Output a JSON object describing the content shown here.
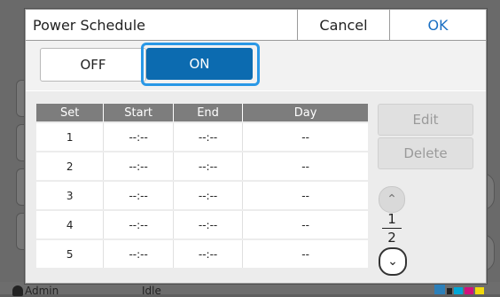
{
  "dialog": {
    "title": "Power Schedule",
    "cancel_label": "Cancel",
    "ok_label": "OK"
  },
  "toggle": {
    "off_label": "OFF",
    "on_label": "ON",
    "selected": "ON"
  },
  "table": {
    "headers": [
      "Set",
      "Start",
      "End",
      "Day"
    ],
    "rows": [
      [
        "1",
        "--:--",
        "--:--",
        "--"
      ],
      [
        "2",
        "--:--",
        "--:--",
        "--"
      ],
      [
        "3",
        "--:--",
        "--:--",
        "--"
      ],
      [
        "4",
        "--:--",
        "--:--",
        "--"
      ],
      [
        "5",
        "--:--",
        "--:--",
        "--"
      ]
    ]
  },
  "actions": {
    "edit_label": "Edit",
    "delete_label": "Delete"
  },
  "pagination": {
    "current": "1",
    "total": "2"
  },
  "background": {
    "user": "Admin",
    "status": "Idle",
    "ink_labels": [
      "K",
      "C",
      "M",
      "Y"
    ]
  },
  "colors": {
    "accent": "#1a6fc3",
    "selected_toggle": "#0c6bb0",
    "focus_ring": "#2a98e6",
    "table_header": "#7d7d7d"
  }
}
